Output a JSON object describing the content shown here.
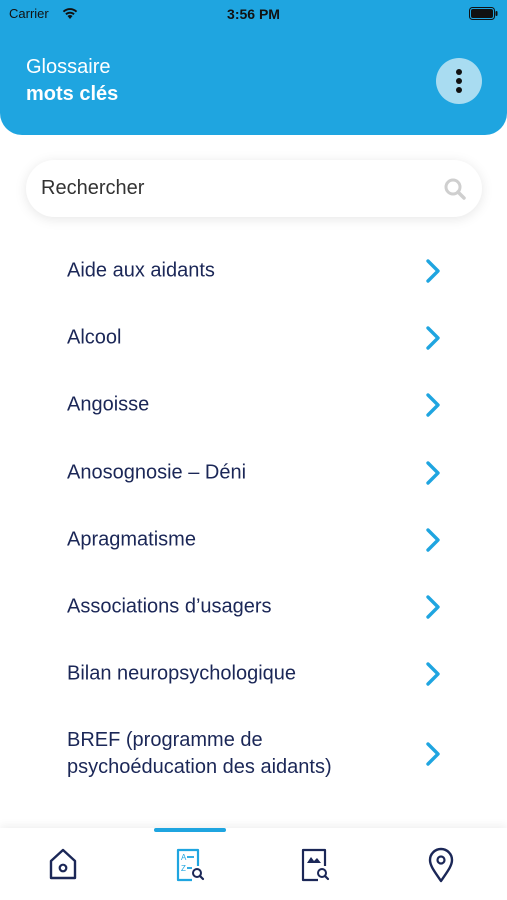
{
  "status_bar": {
    "carrier": "Carrier",
    "time": "3:56 PM"
  },
  "header": {
    "title_line1": "Glossaire",
    "title_line2": "mots clés",
    "menu_icon": "more-vertical-icon"
  },
  "search": {
    "placeholder": "Rechercher",
    "value": "",
    "icon": "search-icon"
  },
  "glossary": {
    "items": [
      {
        "label": "Aide aux aidants"
      },
      {
        "label": "Alcool"
      },
      {
        "label": "Angoisse"
      },
      {
        "label": "Anosognosie – Déni"
      },
      {
        "label": "Apragmatisme"
      },
      {
        "label": "Associations d’usagers"
      },
      {
        "label": "Bilan neuropsychologique"
      },
      {
        "label": "BREF (programme de psychoéducation des aidants)"
      }
    ]
  },
  "tabbar": {
    "active_tab": "glossary",
    "tabs": [
      {
        "id": "home",
        "icon": "home-icon"
      },
      {
        "id": "glossary",
        "icon": "glossary-search-icon"
      },
      {
        "id": "documents",
        "icon": "image-search-icon"
      },
      {
        "id": "map",
        "icon": "location-pin-icon"
      }
    ]
  },
  "colors": {
    "brand": "#1fa5e0",
    "text_dark": "#1b2757",
    "menu_btn_bg": "#a9dcf1"
  }
}
